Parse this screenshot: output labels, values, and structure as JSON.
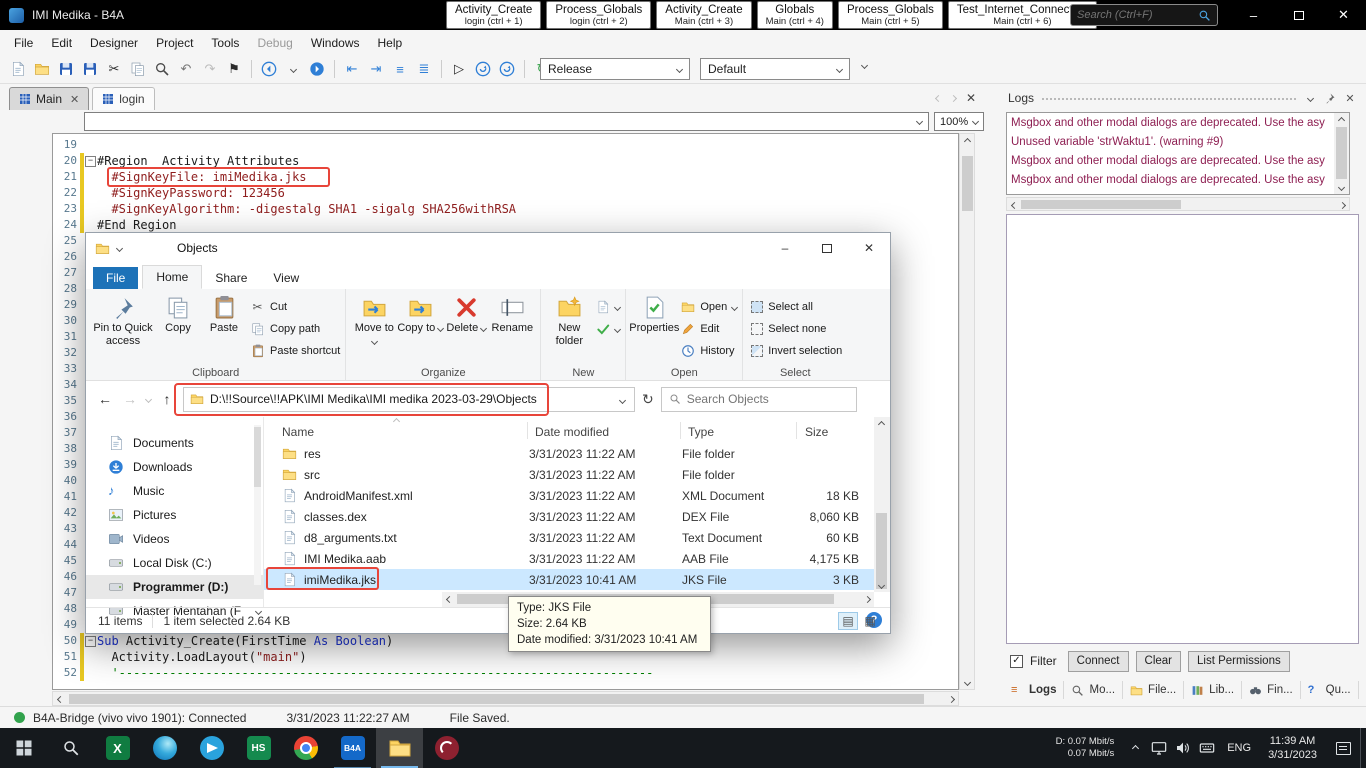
{
  "colors": {
    "annotation-red": "#e8453a",
    "selection-blue": "#cce8ff",
    "accent-blue": "#2f7fd6",
    "log-maroon": "#8e1f52",
    "attr-maroon": "#8f1d1d",
    "string-maroon": "#8f1d1d",
    "keyword-blue": "#1f35d4",
    "comment-green": "#008000"
  },
  "window": {
    "titlebar": {
      "app_title": "IMI Medika - B4A",
      "search_placeholder": "Search (Ctrl+F)",
      "module_tabs": [
        {
          "title": "Activity_Create",
          "subtitle": "login  (ctrl + 1)"
        },
        {
          "title": "Process_Globals",
          "subtitle": "login  (ctrl + 2)"
        },
        {
          "title": "Activity_Create",
          "subtitle": "Main  (ctrl + 3)"
        },
        {
          "title": "Globals",
          "subtitle": "Main  (ctrl + 4)"
        },
        {
          "title": "Process_Globals",
          "subtitle": "Main  (ctrl + 5)"
        },
        {
          "title": "Test_Internet_Connection",
          "subtitle": "Main  (ctrl + 6)"
        }
      ]
    },
    "menubar": {
      "items": [
        {
          "label": "File"
        },
        {
          "label": "Edit"
        },
        {
          "label": "Designer"
        },
        {
          "label": "Project"
        },
        {
          "label": "Tools"
        },
        {
          "label": "Debug",
          "disabled": true
        },
        {
          "label": "Windows"
        },
        {
          "label": "Help"
        }
      ]
    },
    "toolbar": {
      "build_config": "Release",
      "layout_variant": "Default",
      "icons": [
        {
          "name": "new-file-button",
          "svg": "doc"
        },
        {
          "name": "open-project-button",
          "svg": "folder"
        },
        {
          "name": "save-button",
          "svg": "floppy"
        },
        {
          "name": "save-all-button",
          "svg": "floppy"
        },
        {
          "name": "cut-button",
          "g": "✂",
          "c": "dark"
        },
        {
          "name": "copy-button",
          "svg": "copy"
        },
        {
          "name": "find-button",
          "svg": "mag"
        },
        {
          "name": "undo-button",
          "g": "↶",
          "c": "dim"
        },
        {
          "name": "redo-button",
          "g": "↷",
          "c": "faint"
        },
        {
          "name": "bookmark-button",
          "g": "⚑",
          "c": "dark"
        },
        {
          "sep": true
        },
        {
          "name": "navigate-back-button",
          "svg": "backc"
        },
        {
          "name": "back-history-button",
          "chev": true
        },
        {
          "name": "navigate-forward-button",
          "svg": "fwdc"
        },
        {
          "sep": true
        },
        {
          "name": "outdent-button",
          "g": "⇤",
          "c": "blue"
        },
        {
          "name": "indent-button",
          "g": "⇥",
          "c": "blue"
        },
        {
          "name": "comment-button",
          "g": "≡",
          "c": "blue"
        },
        {
          "name": "uncomment-button",
          "g": "≣",
          "c": "blue"
        },
        {
          "sep": true
        },
        {
          "name": "run-button",
          "g": "▷",
          "c": "dark"
        },
        {
          "name": "compile-button",
          "svg": "cirarrow"
        },
        {
          "name": "clean-project-button",
          "svg": "cirarrow"
        },
        {
          "sep": true
        },
        {
          "name": "reload-libraries-button",
          "g": "↻",
          "c": "green"
        }
      ]
    },
    "editor": {
      "tabs": [
        {
          "label": "Main",
          "active": true
        },
        {
          "label": "login"
        }
      ],
      "zoom": "100%",
      "code": [
        {
          "n": 19
        },
        {
          "n": 20,
          "fold": true,
          "mod": true,
          "seg": [
            {
              "c": "plain",
              "t": "#Region  Activity Attributes"
            }
          ]
        },
        {
          "n": 21,
          "mod": true,
          "seg": [
            {
              "c": "attr",
              "t": "  #SignKeyFile: imiMedika.jks"
            }
          ]
        },
        {
          "n": 22,
          "mod": true,
          "seg": [
            {
              "c": "attr",
              "t": "  #SignKeyPassword: 123456"
            }
          ]
        },
        {
          "n": 23,
          "mod": true,
          "seg": [
            {
              "c": "attr",
              "t": "  #SignKeyAlgorithm: -digestalg SHA1 -sigalg SHA256withRSA"
            }
          ]
        },
        {
          "n": 24,
          "mod": true,
          "seg": [
            {
              "c": "plain",
              "t": "#End Region"
            }
          ]
        },
        {
          "n": 25
        },
        {
          "n": 26
        },
        {
          "n": 27
        },
        {
          "n": 28
        },
        {
          "n": 29
        },
        {
          "n": 30
        },
        {
          "n": 31
        },
        {
          "n": 32
        },
        {
          "n": 33
        },
        {
          "n": 34
        },
        {
          "n": 35
        },
        {
          "n": 36
        },
        {
          "n": 37
        },
        {
          "n": 38
        },
        {
          "n": 39
        },
        {
          "n": 40
        },
        {
          "n": 41
        },
        {
          "n": 42
        },
        {
          "n": 43
        },
        {
          "n": 44
        },
        {
          "n": 45
        },
        {
          "n": 46
        },
        {
          "n": 47
        },
        {
          "n": 48
        },
        {
          "n": 49
        },
        {
          "n": 50,
          "fold": true,
          "mod": true,
          "seg": [
            {
              "c": "kw",
              "t": "Sub"
            },
            {
              "c": "plain",
              "t": " Activity_Create(FirstTime "
            },
            {
              "c": "kw",
              "t": "As"
            },
            {
              "c": "plain",
              "t": " "
            },
            {
              "c": "kw",
              "t": "Boolean"
            },
            {
              "c": "plain",
              "t": ")"
            }
          ]
        },
        {
          "n": 51,
          "mod": true,
          "seg": [
            {
              "c": "plain",
              "t": "  Activity.LoadLayout("
            },
            {
              "c": "str",
              "t": "\"main\""
            },
            {
              "c": "plain",
              "t": ")"
            }
          ]
        },
        {
          "n": 52,
          "mod": true,
          "seg": [
            {
              "c": "cmt",
              "t": "  '--------------------------------------------------------------------------"
            }
          ]
        }
      ]
    },
    "logs": {
      "title": "Logs",
      "lines": [
        "Msgbox and other modal dialogs are deprecated. Use the asy",
        "Unused variable 'strWaktu1'. (warning #9)",
        "Msgbox and other modal dialogs are deprecated. Use the asy",
        "Msgbox and other modal dialogs are deprecated. Use the asy"
      ],
      "filter_label": "Filter",
      "filter_checked": true,
      "buttons": [
        {
          "label": "Connect"
        },
        {
          "label": "Clear"
        },
        {
          "label": "List Permissions"
        }
      ],
      "tabs": [
        {
          "label": "Logs",
          "ic": "logs",
          "active": true
        },
        {
          "label": "Mo...",
          "ic": "modules"
        },
        {
          "label": "File...",
          "ic": "files"
        },
        {
          "label": "Lib...",
          "ic": "libs"
        },
        {
          "label": "Fin...",
          "ic": "find"
        },
        {
          "label": "Qu...",
          "ic": "quick"
        }
      ]
    },
    "statusbar": {
      "connection": "B4A-Bridge (vivo vivo 1901): Connected",
      "timestamp": "3/31/2023 11:22:27 AM",
      "file_status": "File Saved."
    }
  },
  "explorer": {
    "title": "Objects",
    "tabs": [
      {
        "label": "File",
        "ic": "file"
      },
      {
        "label": "Home",
        "active": true
      },
      {
        "label": "Share"
      },
      {
        "label": "View"
      }
    ],
    "ribbon": {
      "clipboard": {
        "pin": "Pin to Quick access",
        "copy": "Copy",
        "paste": "Paste",
        "cut": "Cut",
        "copy_path": "Copy path",
        "paste_shortcut": "Paste shortcut",
        "group": "Clipboard"
      },
      "organize": {
        "move_to": "Move to",
        "copy_to": "Copy to",
        "del": "Delete",
        "rename": "Rename",
        "group": "Organize"
      },
      "newgrp": {
        "new_folder": "New folder",
        "group": "New"
      },
      "opengrp": {
        "properties": "Properties",
        "open": "Open",
        "edit": "Edit",
        "history": "History",
        "group": "Open"
      },
      "selectgrp": {
        "all": "Select all",
        "none": "Select none",
        "invert": "Invert selection",
        "group": "Select"
      }
    },
    "address": {
      "path": "D:\\!!Source\\!!APK\\IMI Medika\\IMI medika 2023-03-29\\Objects",
      "search_placeholder": "Search Objects"
    },
    "nav": [
      {
        "label": "Documents",
        "ic": "doc"
      },
      {
        "label": "Downloads",
        "ic": "download"
      },
      {
        "label": "Music",
        "ic": "music"
      },
      {
        "label": "Pictures",
        "ic": "picture"
      },
      {
        "label": "Videos",
        "ic": "video"
      },
      {
        "label": "Local Disk (C:)",
        "ic": "disk"
      },
      {
        "label": "Programmer (D:)",
        "ic": "disk",
        "selected": true
      },
      {
        "label": "Master Mentahan (F",
        "ic": "disk",
        "chev": true
      }
    ],
    "columns": {
      "name": "Name",
      "modified": "Date modified",
      "type": "Type",
      "size": "Size"
    },
    "rows": [
      {
        "name": "res",
        "modified": "3/31/2023 11:22 AM",
        "type": "File folder",
        "size": "",
        "ic": "folder"
      },
      {
        "name": "src",
        "modified": "3/31/2023 11:22 AM",
        "type": "File folder",
        "size": "",
        "ic": "folder"
      },
      {
        "name": "AndroidManifest.xml",
        "modified": "3/31/2023 11:22 AM",
        "type": "XML Document",
        "size": "18 KB",
        "ic": "doc"
      },
      {
        "name": "classes.dex",
        "modified": "3/31/2023 11:22 AM",
        "type": "DEX File",
        "size": "8,060 KB",
        "ic": "doc"
      },
      {
        "name": "d8_arguments.txt",
        "modified": "3/31/2023 11:22 AM",
        "type": "Text Document",
        "size": "60 KB",
        "ic": "doc"
      },
      {
        "name": "IMI Medika.aab",
        "modified": "3/31/2023 11:22 AM",
        "type": "AAB File",
        "size": "4,175 KB",
        "ic": "doc"
      },
      {
        "name": "imiMedika.jks",
        "modified": "3/31/2023 10:41 AM",
        "type": "JKS File",
        "size": "3 KB",
        "ic": "doc",
        "selected": true,
        "annotated": true
      }
    ],
    "status": {
      "items": "11 items",
      "selected": "1 item selected  2.64 KB"
    }
  },
  "tooltip": {
    "lines": [
      "Type: JKS File",
      "Size: 2.64 KB",
      "Date modified: 3/31/2023 10:41 AM"
    ]
  },
  "taskbar": {
    "apps": [
      {
        "id": "start"
      },
      {
        "id": "search"
      },
      {
        "id": "excel",
        "label": "X"
      },
      {
        "id": "edge"
      },
      {
        "id": "telegram"
      },
      {
        "id": "hs",
        "label": "HS"
      },
      {
        "id": "chrome"
      },
      {
        "id": "b4a",
        "label": "B4A",
        "open": true
      },
      {
        "id": "explorer",
        "active": true
      },
      {
        "id": "bridge"
      }
    ],
    "tray": {
      "net_line1": "D: 0.07 Mbit/s",
      "net_line2": "0.07 Mbit/s",
      "language": "ENG",
      "time": "11:39 AM",
      "date": "3/31/2023"
    }
  }
}
